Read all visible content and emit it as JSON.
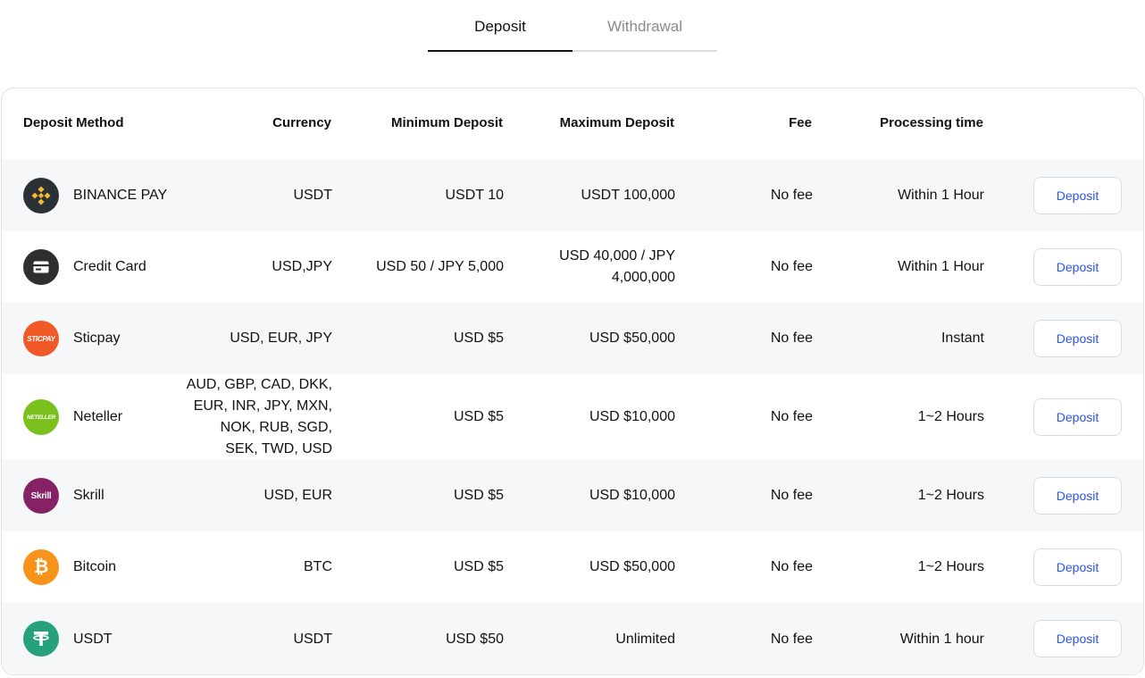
{
  "tabs": {
    "deposit": "Deposit",
    "withdrawal": "Withdrawal"
  },
  "headers": {
    "method": "Deposit Method",
    "currency": "Currency",
    "min": "Minimum Deposit",
    "max": "Maximum Deposit",
    "fee": "Fee",
    "time": "Processing time"
  },
  "rows": [
    {
      "name": "BINANCE PAY",
      "icon": "binance-icon",
      "color": "#2b2f36",
      "currency": "USDT",
      "min": "USDT 10",
      "max": "USDT 100,000",
      "fee": "No fee",
      "time": "Within 1 Hour",
      "button": "Deposit"
    },
    {
      "name": "Credit Card",
      "icon": "credit-card-icon",
      "color": "#2f2f2f",
      "currency": "USD,JPY",
      "min": "USD 50 / JPY 5,000",
      "max": "USD 40,000 / JPY 4,000,000",
      "fee": "No fee",
      "time": "Within 1 Hour",
      "button": "Deposit"
    },
    {
      "name": "Sticpay",
      "icon": "sticpay-icon",
      "color": "#f05a28",
      "logo_text": "STICPAY",
      "currency": "USD, EUR, JPY",
      "min": "USD $5",
      "max": "USD $50,000",
      "fee": "No fee",
      "time": "Instant",
      "button": "Deposit"
    },
    {
      "name": "Neteller",
      "icon": "neteller-icon",
      "color": "#7ac11e",
      "logo_text": "NETELLER",
      "currency": "AUD, GBP, CAD, DKK, EUR, INR, JPY, MXN, NOK, RUB, SGD, SEK, TWD, USD",
      "min": "USD $5",
      "max": "USD $10,000",
      "fee": "No fee",
      "time": "1~2 Hours",
      "button": "Deposit"
    },
    {
      "name": "Skrill",
      "icon": "skrill-icon",
      "color": "#862165",
      "logo_text": "Skrill",
      "currency": "USD, EUR",
      "min": "USD $5",
      "max": "USD $10,000",
      "fee": "No fee",
      "time": "1~2 Hours",
      "button": "Deposit"
    },
    {
      "name": "Bitcoin",
      "icon": "bitcoin-icon",
      "color": "#f7931a",
      "logo_text": "₿",
      "currency": "BTC",
      "min": "USD $5",
      "max": "USD $50,000",
      "fee": "No fee",
      "time": "1~2 Hours",
      "button": "Deposit"
    },
    {
      "name": "USDT",
      "icon": "tether-icon",
      "color": "#26a17b",
      "currency": "USDT",
      "min": "USD $50",
      "max": "Unlimited",
      "fee": "No fee",
      "time": "Within 1 hour",
      "button": "Deposit"
    }
  ]
}
